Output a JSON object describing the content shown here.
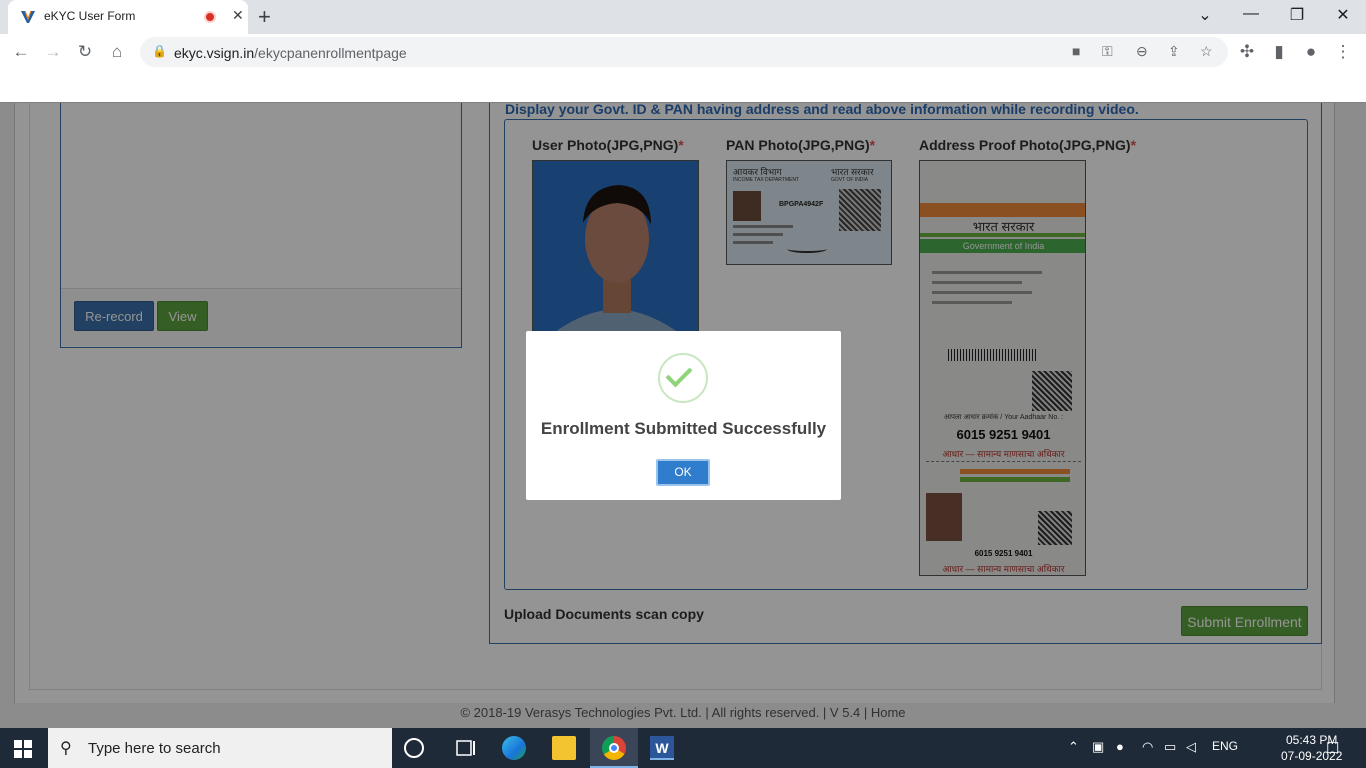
{
  "browser": {
    "tab_title": "eKYC User Form",
    "tab_close": "✕",
    "new_tab": "+",
    "url_host": "ekyc.vsign.in",
    "url_path": "/ekycpanenrollmentpage",
    "window_controls": {
      "dropdown": "⌄",
      "minimize": "—",
      "restore": "❐",
      "close": "✕"
    }
  },
  "left_panel": {
    "rerecord_label": "Re-record",
    "view_label": "View"
  },
  "right_panel": {
    "instruction": "Display your Govt. ID & PAN having address and read above information while recording video.",
    "user_photo_label": "User Photo(JPG,PNG)",
    "pan_photo_label": "PAN Photo(JPG,PNG)",
    "address_photo_label": "Address Proof Photo(JPG,PNG)",
    "required_mark": "*",
    "upload_label": "Upload Documents scan copy",
    "submit_label": "Submit Enrollment"
  },
  "pan_card": {
    "dept_hi": "आयकर विभाग",
    "govt_hi": "भारत सरकार",
    "dept_en": "INCOME TAX DEPARTMENT",
    "govt_en": "GOVT OF INDIA",
    "pan_number": "BPGPA4942F"
  },
  "aadhaar_card": {
    "header_hi": "भारत सरकार",
    "header_en": "Government of India",
    "your_no": "आपला आधार क्रमांक / Your Aadhaar No. :",
    "number": "6015 9251 9401",
    "tagline": "आधार — सामान्य माणसाचा अधिकार"
  },
  "footer": {
    "text": "©  2018-19   Verasys Technologies Pvt. Ltd. | All rights reserved. | V 5.4 | Home"
  },
  "modal": {
    "message": "Enrollment Submitted Successfully",
    "ok_label": "OK"
  },
  "taskbar": {
    "search_placeholder": "Type here to search",
    "language": "ENG",
    "time": "05:43 PM",
    "date": "07-09-2022"
  }
}
